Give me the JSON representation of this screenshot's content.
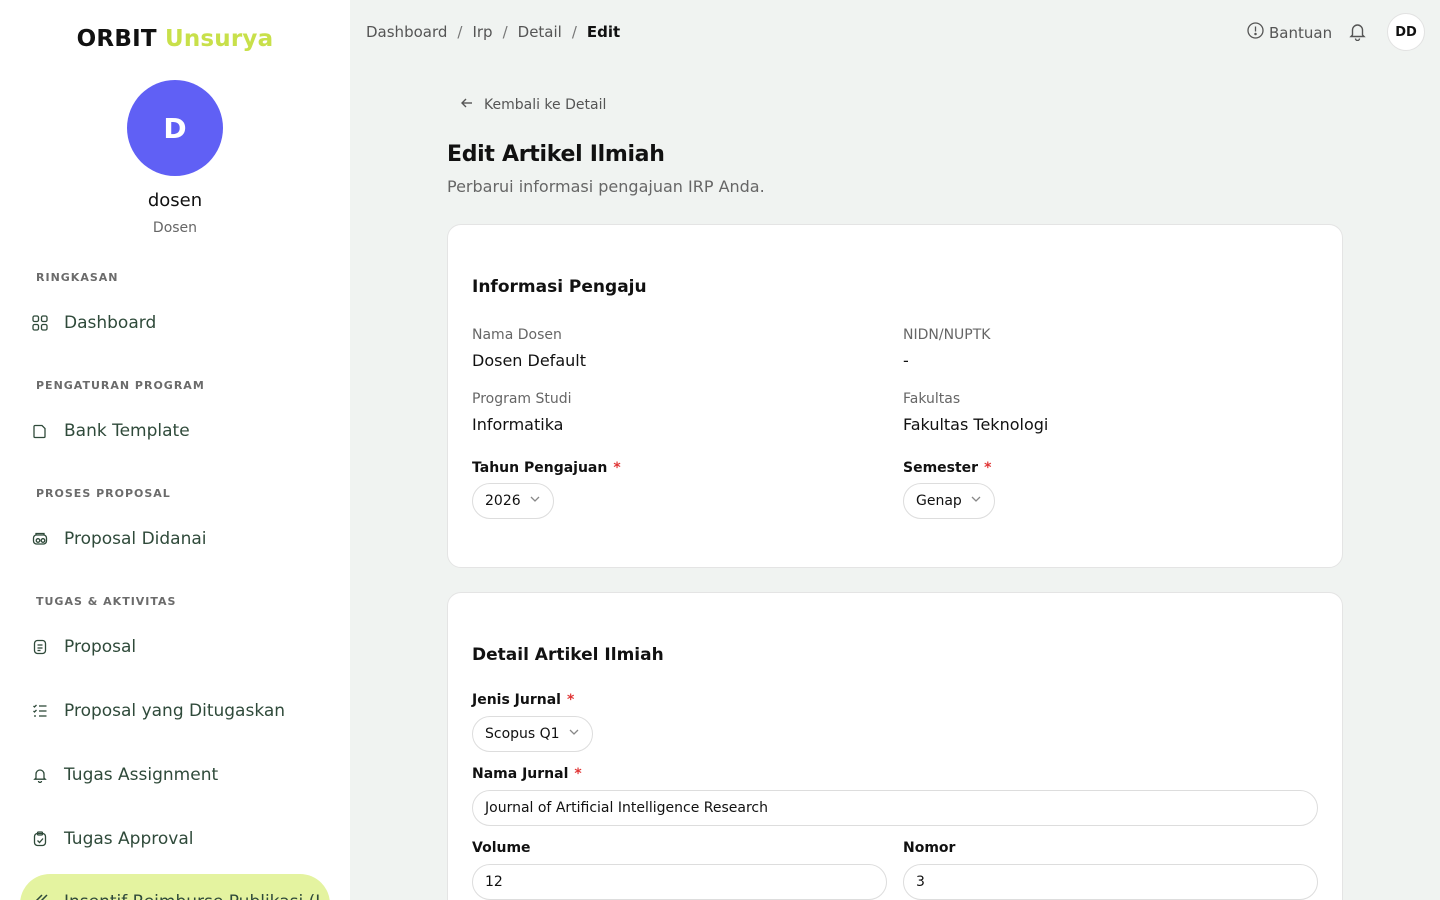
{
  "brand": {
    "part1": "ORBIT",
    "part2": "Unsurya"
  },
  "user": {
    "initial": "D",
    "name": "dosen",
    "role": "Dosen",
    "avatar_initials": "DD"
  },
  "sidebar": {
    "sections": [
      {
        "title": "RINGKASAN"
      },
      {
        "title": "PENGATURAN PROGRAM"
      },
      {
        "title": "PROSES PROPOSAL"
      },
      {
        "title": "TUGAS & AKTIVITAS"
      }
    ],
    "items": [
      {
        "label": "Dashboard",
        "icon": "grid-icon"
      },
      {
        "label": "Bank Template",
        "icon": "document-icon"
      },
      {
        "label": "Proposal Didanai",
        "icon": "money-icon"
      },
      {
        "label": "Proposal",
        "icon": "file-icon"
      },
      {
        "label": "Proposal yang Ditugaskan",
        "icon": "checklist-icon"
      },
      {
        "label": "Tugas Assignment",
        "icon": "bell-icon"
      },
      {
        "label": "Tugas Approval",
        "icon": "clipboard-check-icon"
      },
      {
        "label": "Insentif Reimburse Publikasi (I",
        "icon": "chevrons-left-icon"
      }
    ]
  },
  "breadcrumb": {
    "items": [
      "Dashboard",
      "Irp",
      "Detail"
    ],
    "current": "Edit",
    "separator": "/"
  },
  "header": {
    "help_label": "Bantuan"
  },
  "main": {
    "back_label": "Kembali ke Detail",
    "title": "Edit Artikel Ilmiah",
    "subtitle": "Perbarui informasi pengajuan IRP Anda."
  },
  "info_card": {
    "title": "Informasi Pengaju",
    "nama_dosen_label": "Nama Dosen",
    "nama_dosen_value": "Dosen Default",
    "nidn_label": "NIDN/NUPTK",
    "nidn_value": "-",
    "prodi_label": "Program Studi",
    "prodi_value": "Informatika",
    "fakultas_label": "Fakultas",
    "fakultas_value": "Fakultas Teknologi",
    "tahun_label": "Tahun Pengajuan",
    "tahun_value": "2026",
    "semester_label": "Semester",
    "semester_value": "Genap",
    "required_mark": "*"
  },
  "detail_card": {
    "title": "Detail Artikel Ilmiah",
    "jenis_label": "Jenis Jurnal",
    "jenis_value": "Scopus Q1",
    "nama_jurnal_label": "Nama Jurnal",
    "nama_jurnal_value": "Journal of Artificial Intelligence Research",
    "volume_label": "Volume",
    "volume_value": "12",
    "nomor_label": "Nomor",
    "nomor_value": "3",
    "required_mark": "*"
  },
  "colors": {
    "accent": "#c8e04a",
    "avatar": "#6060f5",
    "active_bg": "#e4f3a0",
    "required": "#e03434"
  }
}
